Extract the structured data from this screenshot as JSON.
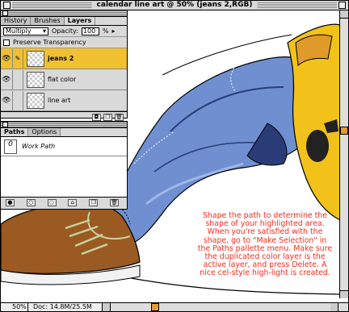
{
  "window": {
    "title": "calendar line art @ 50% (jeans 2,RGB)"
  },
  "layers_palette": {
    "tabs": [
      "History",
      "Brushes",
      "Layers"
    ],
    "active_tab": "Layers",
    "blend_mode": "Multiply",
    "opacity_label": "Opacity:",
    "opacity_value": "100",
    "opacity_unit": "%",
    "preserve_transparency_label": "Preserve Transparency",
    "layers": [
      {
        "name": "jeans 2",
        "active": true
      },
      {
        "name": "flat color",
        "active": false
      },
      {
        "name": "line art",
        "active": false
      }
    ]
  },
  "paths_palette": {
    "tabs": [
      "Paths",
      "Options"
    ],
    "active_tab": "Paths",
    "paths": [
      {
        "name": "Work Path"
      }
    ]
  },
  "status": {
    "zoom": "50%",
    "doc": "Doc: 14.8M/25.5M"
  },
  "caption": "Shape the path to determine the shape of your highlighted area. When you're satisfied with the shape, go to \"Make Selection\" in the Paths pallette menu.  Make sure the duplicated color layer is the active layer, and press Delete.  A nice cel-style high-light is created.",
  "colors": {
    "accent": "#f0c030",
    "caption": "#ff2a1a",
    "jeans": "#6f8fd0",
    "boot": "#9a5a22"
  },
  "icons": [
    "eye-icon",
    "brush-icon",
    "close-icon",
    "trash-icon",
    "new-layer-icon",
    "mask-icon"
  ]
}
